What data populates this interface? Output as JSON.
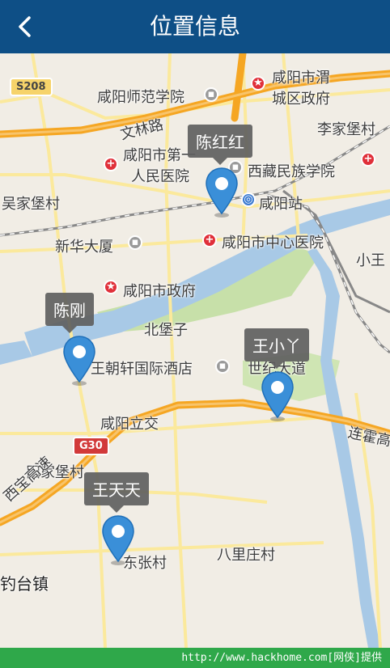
{
  "header": {
    "title": "位置信息",
    "back_icon": "chevron-left-icon"
  },
  "map": {
    "road_badges": {
      "s208": "S208",
      "g30": "G30"
    },
    "labels": {
      "shifan": "咸阳师范学院",
      "weicheng_1": "咸阳市渭",
      "weicheng_2": "城区政府",
      "wenlinlu": "文林路",
      "lijiabao": "李家堡村",
      "diyi_1": "咸阳市第一",
      "diyi_2": "人民医院",
      "xizang": "西藏民族学院",
      "wujiabao": "吴家堡村",
      "zhan": "咸阳站",
      "xinhua": "新华大厦",
      "zhongxin": "咸阳市中心医院",
      "xiaowang": "小王",
      "zhengfu": "咸阳市政府",
      "beibaozi": "北堡子",
      "hotel": "王朝轩国际酒店",
      "shiji": "世纪大道",
      "lijiao": "咸阳立交",
      "lianhuo": "连霍高",
      "tianjiabao": "田家堡村",
      "xibao": "西宝高速",
      "dongzhang": "东张村",
      "balizhuang": "八里庄村",
      "diaotai": "钓台镇"
    },
    "markers": [
      {
        "name": "陈红红"
      },
      {
        "name": "陈刚"
      },
      {
        "name": "王小丫"
      },
      {
        "name": "王天天"
      }
    ],
    "colors": {
      "pin": "#3a8fd8",
      "callout": "#5f5f5f",
      "water": "#a8c9e6",
      "park": "#c7e0a9",
      "highway": "#f5a623",
      "road": "#fbe99c"
    }
  },
  "footer": {
    "text": "http://www.hackhome.com[网侠]提供"
  }
}
